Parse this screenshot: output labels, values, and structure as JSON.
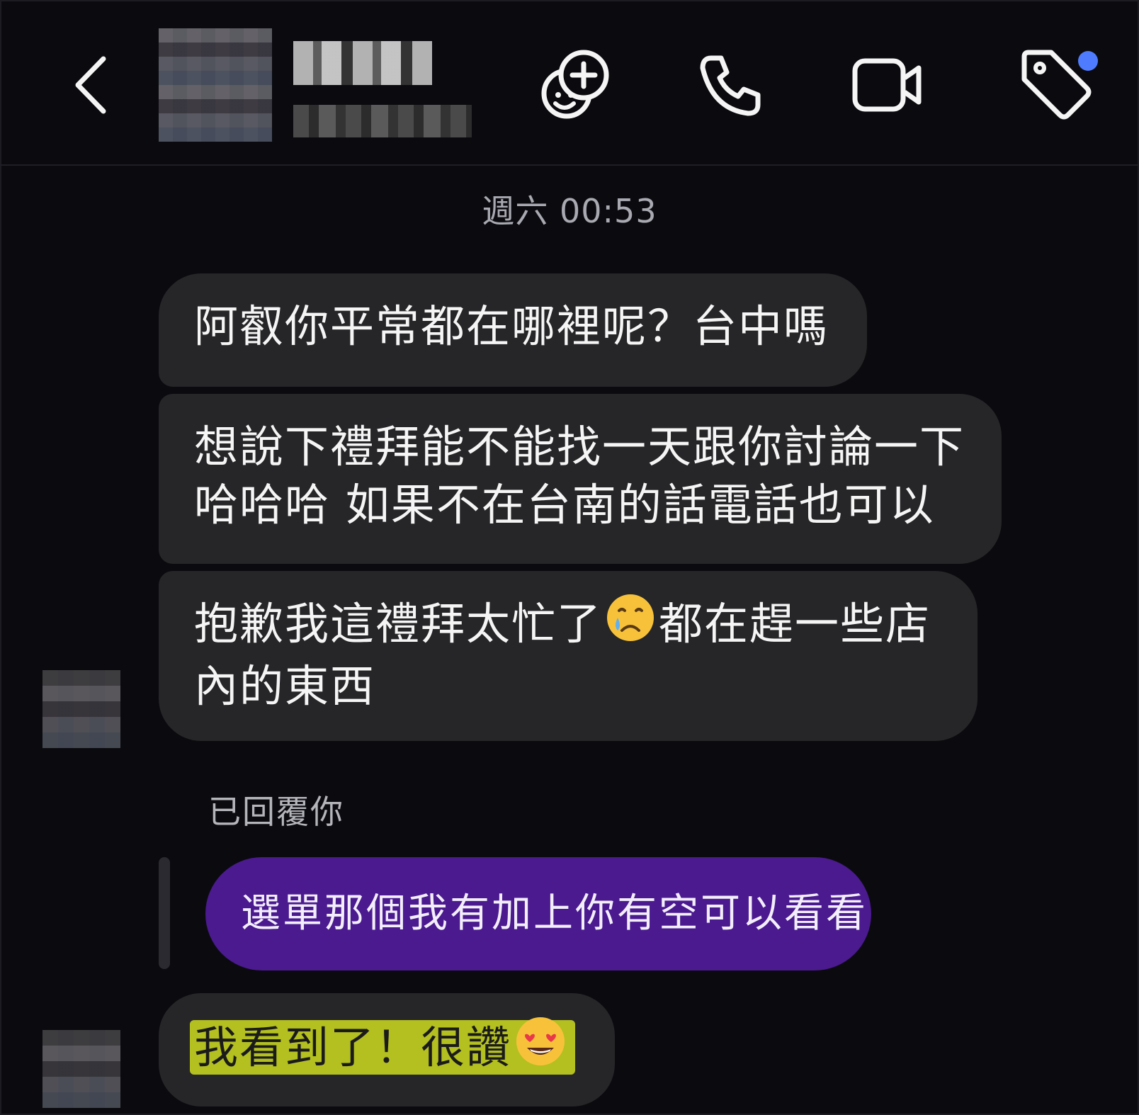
{
  "header": {
    "back_icon": "chevron-left-icon",
    "contact_name": "(blurred)",
    "contact_status": "(blurred)",
    "actions": [
      "sticker-add-icon",
      "phone-icon",
      "video-camera-icon",
      "tag-icon"
    ],
    "notification_dot_color": "#4f7cff"
  },
  "timestamp": "週六 00:53",
  "messages": [
    {
      "sender": "them",
      "text": "阿叡你平常都在哪裡呢？台中嗎"
    },
    {
      "sender": "them",
      "line1": "想說下禮拜能不能找一天跟你討論一下",
      "line2": "哈哈哈 如果不在台南的話電話也可以"
    },
    {
      "sender": "them",
      "line1_before": "抱歉我這禮拜太忙了",
      "emoji": "crying-face",
      "line1_after": "都在趕一些店",
      "line2": "內的東西"
    },
    {
      "reply_label": "已回覆你"
    },
    {
      "sender": "me",
      "text": "選單那個我有加上你有空可以看看",
      "color": "#4a1a8e"
    },
    {
      "sender": "them",
      "text": "我看到了！很讚",
      "emoji": "heart-eyes-face",
      "highlight_color": "#cddc1e"
    }
  ]
}
